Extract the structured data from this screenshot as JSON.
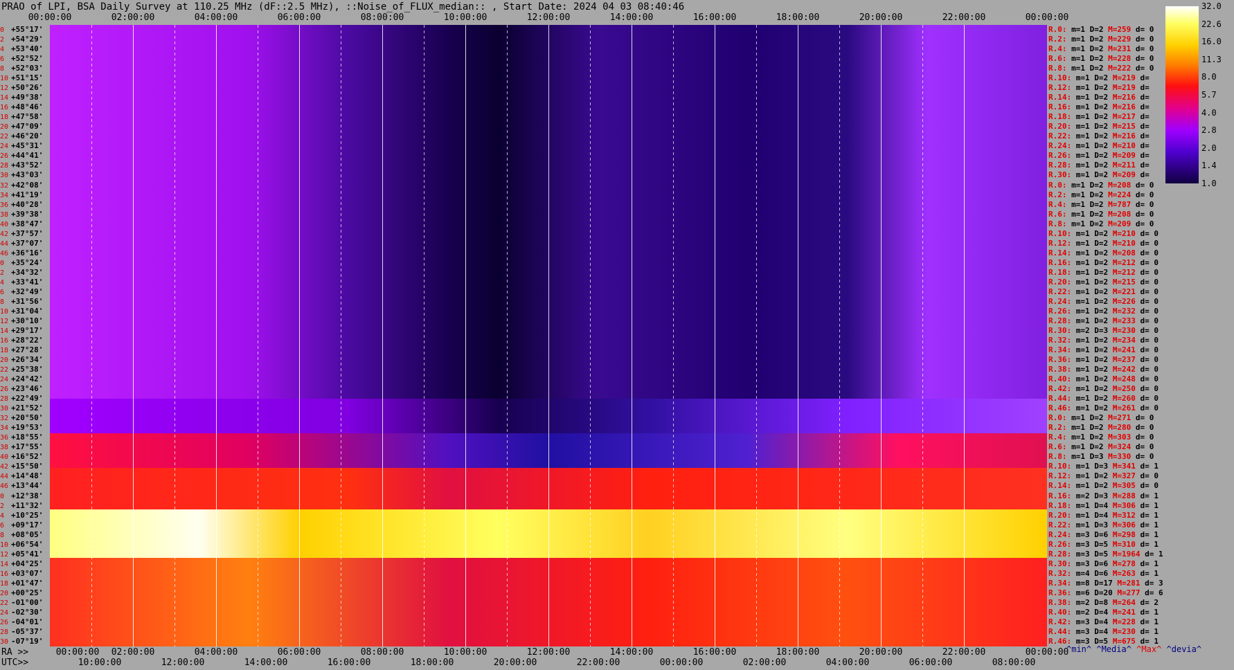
{
  "title": "PRAO of LPI, BSA Daily Survey at 110.25 MHz (dF::2.5 MHz), ::Noise_of_FLUX_median:: , Start Date: 2024 04 03 08:40:46",
  "top_axis_ticks": [
    "00:00:00",
    "02:00:00",
    "04:00:00",
    "06:00:00",
    "08:00:00",
    "10:00:00",
    "12:00:00",
    "14:00:00",
    "16:00:00",
    "18:00:00",
    "20:00:00",
    "22:00:00",
    "00:00:00"
  ],
  "ra_axis_label": "RA >>",
  "ra_axis_ticks": [
    "00:00:00",
    "02:00:00",
    "04:00:00",
    "06:00:00",
    "08:00:00",
    "10:00:00",
    "12:00:00",
    "14:00:00",
    "16:00:00",
    "18:00:00",
    "20:00:00",
    "22:00:00",
    "00:00:00"
  ],
  "utc_axis_label": "UTC>>",
  "utc_axis_ticks": [
    "10:00:00",
    "12:00:00",
    "14:00:00",
    "16:00:00",
    "18:00:00",
    "20:00:00",
    "22:00:00",
    "00:00:00",
    "02:00:00",
    "04:00:00",
    "06:00:00",
    "08:00:00"
  ],
  "declinations": [
    "+55°17'",
    "+54°29'",
    "+53°40'",
    "+52°52'",
    "+52°03'",
    "+51°15'",
    "+50°26'",
    "+49°38'",
    "+48°46'",
    "+47°58'",
    "+47°09'",
    "+46°20'",
    "+45°31'",
    "+44°41'",
    "+43°52'",
    "+43°03'",
    "+42°08'",
    "+41°19'",
    "+40°28'",
    "+39°38'",
    "+38°47'",
    "+37°57'",
    "+37°07'",
    "+36°16'",
    "+35°24'",
    "+34°32'",
    "+33°41'",
    "+32°49'",
    "+31°56'",
    "+31°04'",
    "+30°10'",
    "+29°17'",
    "+28°22'",
    "+27°28'",
    "+26°34'",
    "+25°38'",
    "+24°42'",
    "+23°46'",
    "+22°49'",
    "+21°52'",
    "+20°50'",
    "+19°53'",
    "+18°55'",
    "+17°55'",
    "+16°52'",
    "+15°50'",
    "+14°48'",
    "+13°44'",
    "+12°38'",
    "+11°32'",
    "+10°25'",
    "+09°17'",
    "+08°05'",
    "+06°54'",
    "+05°41'",
    "+04°25'",
    "+03°07'",
    "+01°47'",
    "+00°25'",
    "-01°00'",
    "-02°30'",
    "-04°01'",
    "-05°37'",
    "-07°19'"
  ],
  "stats": [
    {
      "r": "R.0:",
      "m": "m=1",
      "d": "D=2",
      "mx": "M=259",
      "dv": "d= 0"
    },
    {
      "r": "R.2:",
      "m": "m=1",
      "d": "D=2",
      "mx": "M=229",
      "dv": "d= 0"
    },
    {
      "r": "R.4:",
      "m": "m=1",
      "d": "D=2",
      "mx": "M=231",
      "dv": "d= 0"
    },
    {
      "r": "R.6:",
      "m": "m=1",
      "d": "D=2",
      "mx": "M=228",
      "dv": "d= 0"
    },
    {
      "r": "R.8:",
      "m": "m=1",
      "d": "D=2",
      "mx": "M=222",
      "dv": "d= 0"
    },
    {
      "r": "R.10:",
      "m": "m=1",
      "d": "D=2",
      "mx": "M=219",
      "dv": "d="
    },
    {
      "r": "R.12:",
      "m": "m=1",
      "d": "D=2",
      "mx": "M=219",
      "dv": "d="
    },
    {
      "r": "R.14:",
      "m": "m=1",
      "d": "D=2",
      "mx": "M=216",
      "dv": "d="
    },
    {
      "r": "R.16:",
      "m": "m=1",
      "d": "D=2",
      "mx": "M=216",
      "dv": "d="
    },
    {
      "r": "R.18:",
      "m": "m=1",
      "d": "D=2",
      "mx": "M=217",
      "dv": "d="
    },
    {
      "r": "R.20:",
      "m": "m=1",
      "d": "D=2",
      "mx": "M=215",
      "dv": "d="
    },
    {
      "r": "R.22:",
      "m": "m=1",
      "d": "D=2",
      "mx": "M=216",
      "dv": "d="
    },
    {
      "r": "R.24:",
      "m": "m=1",
      "d": "D=2",
      "mx": "M=210",
      "dv": "d="
    },
    {
      "r": "R.26:",
      "m": "m=1",
      "d": "D=2",
      "mx": "M=209",
      "dv": "d="
    },
    {
      "r": "R.28:",
      "m": "m=1",
      "d": "D=2",
      "mx": "M=211",
      "dv": "d="
    },
    {
      "r": "R.30:",
      "m": "m=1",
      "d": "D=2",
      "mx": "M=209",
      "dv": "d="
    },
    {
      "r": "R.0:",
      "m": "m=1",
      "d": "D=2",
      "mx": "M=208",
      "dv": "d= 0"
    },
    {
      "r": "R.2:",
      "m": "m=1",
      "d": "D=2",
      "mx": "M=224",
      "dv": "d= 0"
    },
    {
      "r": "R.4:",
      "m": "m=1",
      "d": "D=2",
      "mx": "M=787",
      "dv": "d= 0"
    },
    {
      "r": "R.6:",
      "m": "m=1",
      "d": "D=2",
      "mx": "M=208",
      "dv": "d= 0"
    },
    {
      "r": "R.8:",
      "m": "m=1",
      "d": "D=2",
      "mx": "M=209",
      "dv": "d= 0"
    },
    {
      "r": "R.10:",
      "m": "m=1",
      "d": "D=2",
      "mx": "M=210",
      "dv": "d= 0"
    },
    {
      "r": "R.12:",
      "m": "m=1",
      "d": "D=2",
      "mx": "M=210",
      "dv": "d= 0"
    },
    {
      "r": "R.14:",
      "m": "m=1",
      "d": "D=2",
      "mx": "M=208",
      "dv": "d= 0"
    },
    {
      "r": "R.16:",
      "m": "m=1",
      "d": "D=2",
      "mx": "M=212",
      "dv": "d= 0"
    },
    {
      "r": "R.18:",
      "m": "m=1",
      "d": "D=2",
      "mx": "M=212",
      "dv": "d= 0"
    },
    {
      "r": "R.20:",
      "m": "m=1",
      "d": "D=2",
      "mx": "M=215",
      "dv": "d= 0"
    },
    {
      "r": "R.22:",
      "m": "m=1",
      "d": "D=2",
      "mx": "M=221",
      "dv": "d= 0"
    },
    {
      "r": "R.24:",
      "m": "m=1",
      "d": "D=2",
      "mx": "M=226",
      "dv": "d= 0"
    },
    {
      "r": "R.26:",
      "m": "m=1",
      "d": "D=2",
      "mx": "M=232",
      "dv": "d= 0"
    },
    {
      "r": "R.28:",
      "m": "m=1",
      "d": "D=2",
      "mx": "M=233",
      "dv": "d= 0"
    },
    {
      "r": "R.30:",
      "m": "m=2",
      "d": "D=3",
      "mx": "M=230",
      "dv": "d= 0"
    },
    {
      "r": "R.32:",
      "m": "m=1",
      "d": "D=2",
      "mx": "M=234",
      "dv": "d= 0"
    },
    {
      "r": "R.34:",
      "m": "m=1",
      "d": "D=2",
      "mx": "M=241",
      "dv": "d= 0"
    },
    {
      "r": "R.36:",
      "m": "m=1",
      "d": "D=2",
      "mx": "M=237",
      "dv": "d= 0"
    },
    {
      "r": "R.38:",
      "m": "m=1",
      "d": "D=2",
      "mx": "M=242",
      "dv": "d= 0"
    },
    {
      "r": "R.40:",
      "m": "m=1",
      "d": "D=2",
      "mx": "M=248",
      "dv": "d= 0"
    },
    {
      "r": "R.42:",
      "m": "m=1",
      "d": "D=2",
      "mx": "M=250",
      "dv": "d= 0"
    },
    {
      "r": "R.44:",
      "m": "m=1",
      "d": "D=2",
      "mx": "M=260",
      "dv": "d= 0"
    },
    {
      "r": "R.46:",
      "m": "m=1",
      "d": "D=2",
      "mx": "M=261",
      "dv": "d= 0"
    },
    {
      "r": "R.0:",
      "m": "m=1",
      "d": "D=2",
      "mx": "M=271",
      "dv": "d= 0"
    },
    {
      "r": "R.2:",
      "m": "m=1",
      "d": "D=2",
      "mx": "M=280",
      "dv": "d= 0"
    },
    {
      "r": "R.4:",
      "m": "m=1",
      "d": "D=2",
      "mx": "M=303",
      "dv": "d= 0"
    },
    {
      "r": "R.6:",
      "m": "m=1",
      "d": "D=2",
      "mx": "M=324",
      "dv": "d= 0"
    },
    {
      "r": "R.8:",
      "m": "m=1",
      "d": "D=3",
      "mx": "M=330",
      "dv": "d= 0"
    },
    {
      "r": "R.10:",
      "m": "m=1",
      "d": "D=3",
      "mx": "M=341",
      "dv": "d= 1"
    },
    {
      "r": "R.12:",
      "m": "m=1",
      "d": "D=2",
      "mx": "M=327",
      "dv": "d= 0"
    },
    {
      "r": "R.14:",
      "m": "m=1",
      "d": "D=2",
      "mx": "M=305",
      "dv": "d= 0"
    },
    {
      "r": "R.16:",
      "m": "m=2",
      "d": "D=3",
      "mx": "M=288",
      "dv": "d= 1"
    },
    {
      "r": "R.18:",
      "m": "m=1",
      "d": "D=4",
      "mx": "M=306",
      "dv": "d= 1"
    },
    {
      "r": "R.20:",
      "m": "m=1",
      "d": "D=4",
      "mx": "M=312",
      "dv": "d= 1"
    },
    {
      "r": "R.22:",
      "m": "m=1",
      "d": "D=3",
      "mx": "M=306",
      "dv": "d= 1"
    },
    {
      "r": "R.24:",
      "m": "m=3",
      "d": "D=6",
      "mx": "M=298",
      "dv": "d= 1"
    },
    {
      "r": "R.26:",
      "m": "m=3",
      "d": "D=5",
      "mx": "M=310",
      "dv": "d= 1"
    },
    {
      "r": "R.28:",
      "m": "m=3",
      "d": "D=5",
      "mx": "M=1964",
      "dv": "d= 1"
    },
    {
      "r": "R.30:",
      "m": "m=3",
      "d": "D=6",
      "mx": "M=278",
      "dv": "d= 1"
    },
    {
      "r": "R.32:",
      "m": "m=4",
      "d": "D=6",
      "mx": "M=263",
      "dv": "d= 1"
    },
    {
      "r": "R.34:",
      "m": "m=8",
      "d": "D=17",
      "mx": "M=281",
      "dv": "d= 3"
    },
    {
      "r": "R.36:",
      "m": "m=6",
      "d": "D=20",
      "mx": "M=277",
      "dv": "d= 6"
    },
    {
      "r": "R.38:",
      "m": "m=2",
      "d": "D=8",
      "mx": "M=264",
      "dv": "d= 2"
    },
    {
      "r": "R.40:",
      "m": "m=2",
      "d": "D=4",
      "mx": "M=241",
      "dv": "d= 1"
    },
    {
      "r": "R.42:",
      "m": "m=3",
      "d": "D=4",
      "mx": "M=228",
      "dv": "d= 1"
    },
    {
      "r": "R.44:",
      "m": "m=3",
      "d": "D=4",
      "mx": "M=230",
      "dv": "d= 1"
    },
    {
      "r": "R.46:",
      "m": "m=3",
      "d": "D=5",
      "mx": "M=675",
      "dv": "d= 1"
    }
  ],
  "legend_footer": {
    "min": "^min^",
    "median": "^Media^",
    "max": "^Max^",
    "dev": "^devia^"
  },
  "colorbar": {
    "labels": [
      "32.0",
      "22.6",
      "16.0",
      "11.3",
      "8.0",
      "5.7",
      "4.0",
      "2.8",
      "2.0",
      "1.4",
      "1.0"
    ]
  },
  "colors": {
    "background": "#a8a8a8",
    "low": "#100040",
    "mid": "#a000ff",
    "high": "#ff1010",
    "peak": "#ffff60"
  }
}
